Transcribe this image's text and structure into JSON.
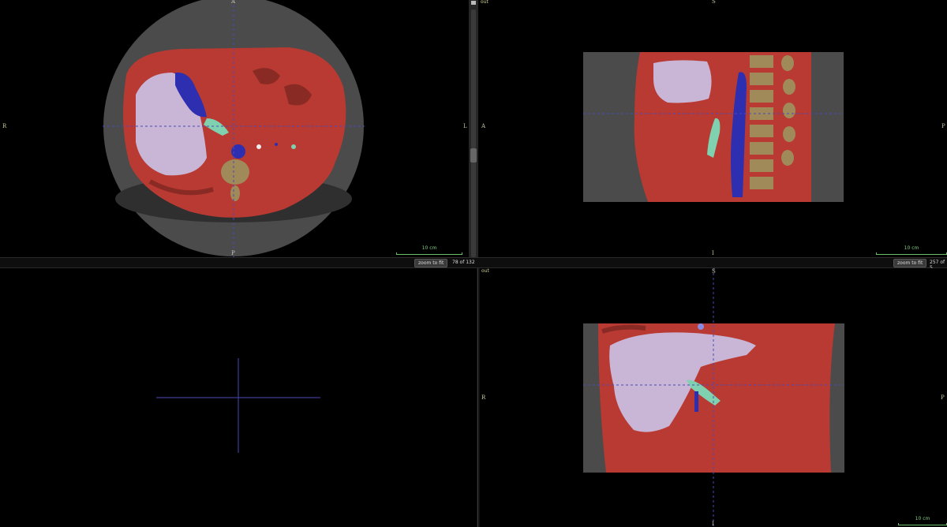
{
  "top_left": {
    "orientation": {
      "top": "A",
      "left": "R",
      "right": "L",
      "bottom": "P"
    },
    "scale_label": "10 cm",
    "zoom_button": "zoom to fit",
    "slice": "78 of 132"
  },
  "top_right": {
    "pane_label": "out",
    "orientation": {
      "top": "S",
      "left": "A",
      "right": "P",
      "bottom": "I"
    },
    "scale_label": "10 cm",
    "zoom_button": "zoom to fit",
    "slice": "257 of 5"
  },
  "bottom_right": {
    "pane_label": "out",
    "orientation": {
      "top": "S",
      "left": "R",
      "right": "P",
      "bottom": "I"
    },
    "scale_label": "10 cm"
  },
  "colors": {
    "tissue": "#b83a32",
    "liver": "#c9b6d6",
    "vessel": "#2e2fb0",
    "portal": "#7fd1b0",
    "bone": "#a08a5a",
    "crosshair": "#4a4ab8",
    "scale": "#6bbf6b"
  }
}
